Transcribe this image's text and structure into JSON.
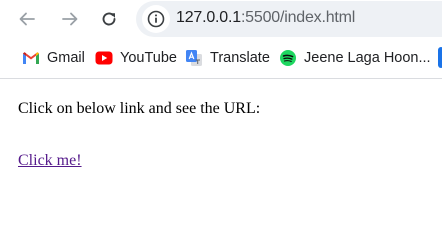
{
  "toolbar": {
    "back_icon": "arrow-left-icon",
    "forward_icon": "arrow-right-icon",
    "reload_icon": "reload-icon",
    "site_info_icon": "info-icon",
    "url_host": "127.0.0.1",
    "url_rest": ":5500/index.html"
  },
  "bookmarks": [
    {
      "label": "Gmail",
      "icon": "gmail-icon"
    },
    {
      "label": "YouTube",
      "icon": "youtube-icon"
    },
    {
      "label": "Translate",
      "icon": "translate-icon"
    },
    {
      "label": "Jeene Laga Hoon...",
      "icon": "spotify-icon"
    }
  ],
  "page": {
    "intro_text": "Click on below link and see the URL:",
    "link_text": "Click me!"
  },
  "colors": {
    "link_visited": "#551a8b",
    "omnibox_bg": "#eef1f5",
    "youtube_red": "#ff0000",
    "spotify_green": "#1ed760"
  }
}
